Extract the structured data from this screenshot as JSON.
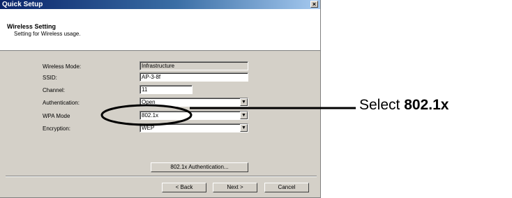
{
  "window": {
    "title": "Quick Setup",
    "close_glyph": "×"
  },
  "header": {
    "title": "Wireless Setting",
    "subtitle": "Setting for Wireless usage."
  },
  "form": {
    "wireless_mode": {
      "label": "Wireless Mode:",
      "value": "Infrastructure"
    },
    "ssid": {
      "label": "SSID:",
      "value": "AP-3-8f"
    },
    "channel": {
      "label": "Channel:",
      "value": "11"
    },
    "authentication": {
      "label": "Authentication:",
      "value": "Open"
    },
    "wpa_mode": {
      "label": "WPA Mode",
      "value": "802.1x"
    },
    "encryption": {
      "label": "Encryption:",
      "value": "WEP"
    }
  },
  "buttons": {
    "auth": "802.1x Authentication...",
    "back": "< Back",
    "next": "Next >",
    "cancel": "Cancel"
  },
  "annotation": {
    "prefix": "Select ",
    "emphasis": "802.1x"
  },
  "colors": {
    "dialog_bg": "#d4d0c8",
    "titlebar": "#0a246a"
  }
}
